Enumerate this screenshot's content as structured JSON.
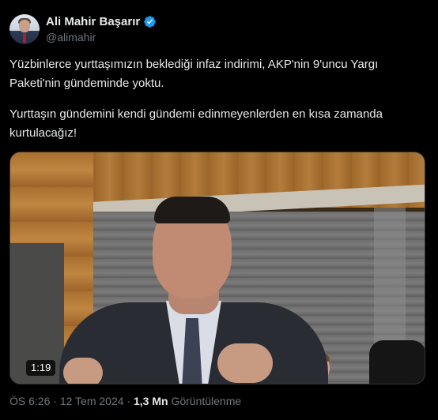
{
  "author": {
    "name": "Ali Mahir Başarır",
    "handle": "@alimahir",
    "verified_icon": "verified-badge-icon",
    "verified_color": "#1d9bf0"
  },
  "tweet": {
    "paragraph_1": "Yüzbinlerce yurttaşımızın beklediği infaz indirimi, AKP'nin 9'uncu Yargı Paketi'nin gündeminde yoktu.",
    "paragraph_2": "Yurttaşın gündemini kendi gündemi edinmeyenlerden en kısa zamanda kurtulacağız!"
  },
  "media": {
    "type": "video",
    "duration": "1:19"
  },
  "meta": {
    "time": "ÖS 6:26",
    "separator_1": " · ",
    "date": "12 Tem 2024",
    "separator_2": " · ",
    "views_count": "1,3 Mn",
    "views_label": " Görüntülenme"
  },
  "colors": {
    "background": "#000000",
    "text": "#e7e9ea",
    "secondary": "#71767b"
  }
}
